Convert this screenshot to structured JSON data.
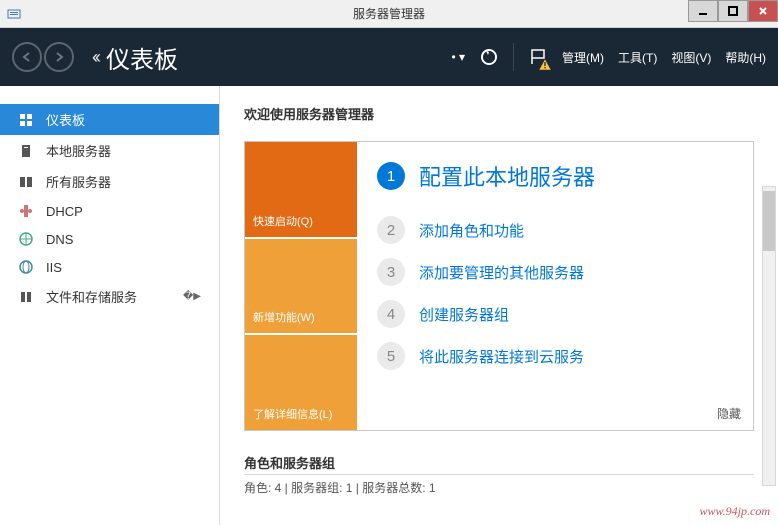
{
  "window": {
    "title": "服务器管理器"
  },
  "header": {
    "title": "仪表板",
    "menu_manage": "管理(M)",
    "menu_tools": "工具(T)",
    "menu_view": "视图(V)",
    "menu_help": "帮助(H)"
  },
  "sidebar": {
    "items": [
      {
        "label": "仪表板"
      },
      {
        "label": "本地服务器"
      },
      {
        "label": "所有服务器"
      },
      {
        "label": "DHCP"
      },
      {
        "label": "DNS"
      },
      {
        "label": "IIS"
      },
      {
        "label": "文件和存储服务"
      }
    ]
  },
  "main": {
    "welcome": "欢迎使用服务器管理器",
    "tabs": {
      "quickstart": "快速启动(Q)",
      "whatsnew": "新增功能(W)",
      "learnmore": "了解详细信息(L)"
    },
    "steps": [
      {
        "num": "1",
        "text": "配置此本地服务器"
      },
      {
        "num": "2",
        "text": "添加角色和功能"
      },
      {
        "num": "3",
        "text": "添加要管理的其他服务器"
      },
      {
        "num": "4",
        "text": "创建服务器组"
      },
      {
        "num": "5",
        "text": "将此服务器连接到云服务"
      }
    ],
    "hide": "隐藏",
    "roles_title": "角色和服务器组",
    "roles_sub": "角色: 4 | 服务器组: 1 | 服务器总数: 1"
  },
  "watermark": "www.94jp.com"
}
